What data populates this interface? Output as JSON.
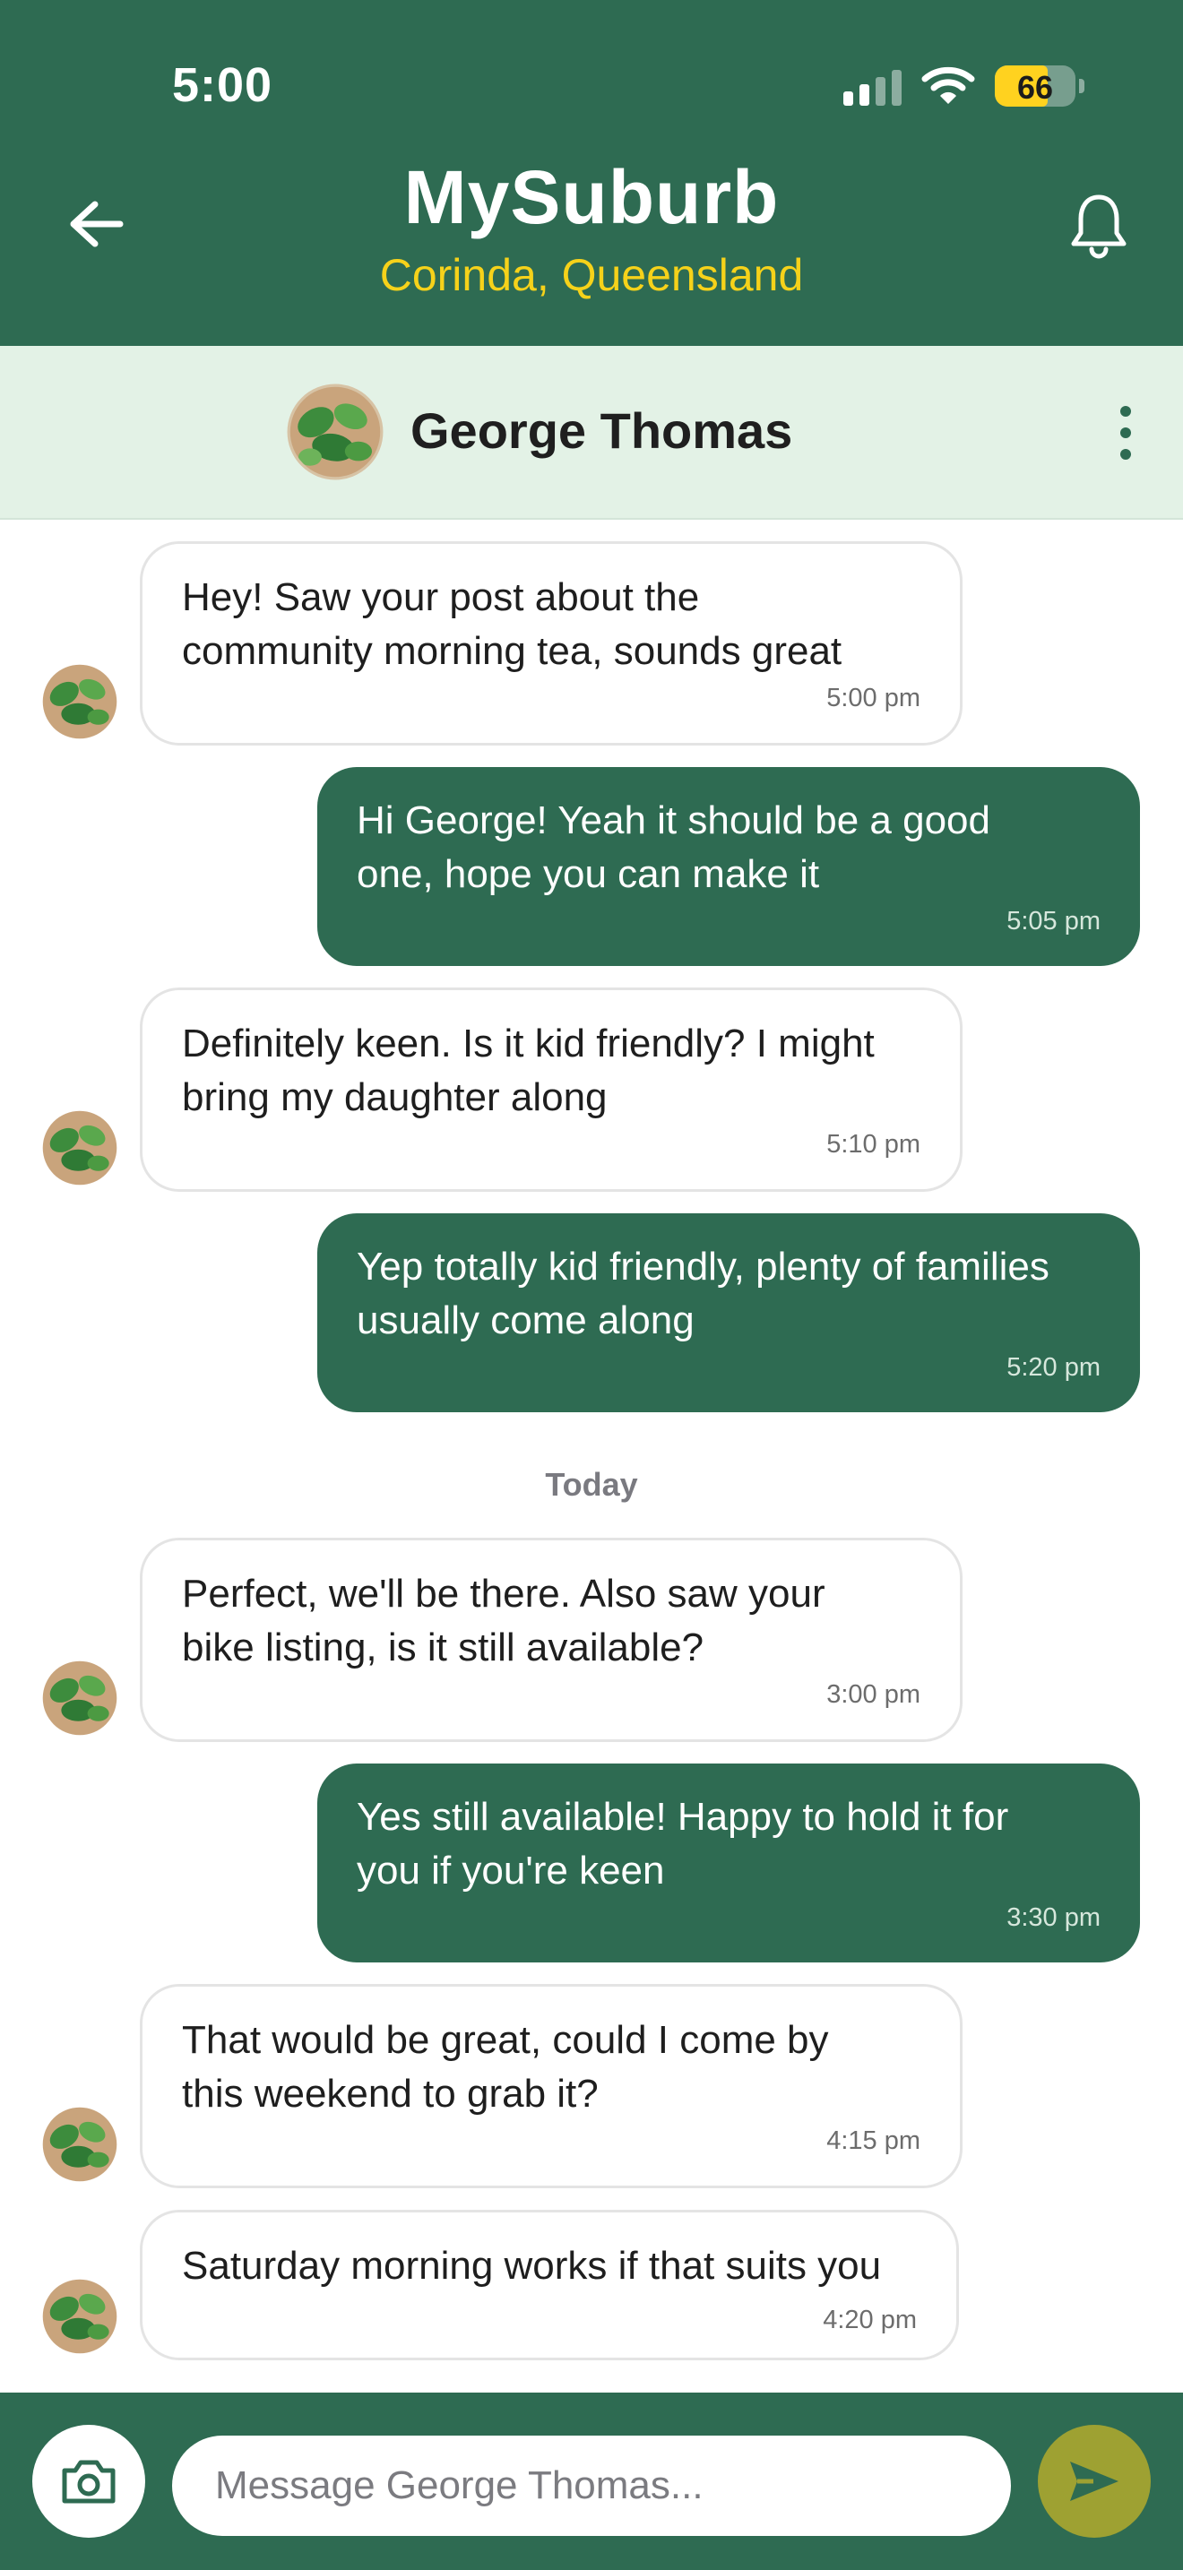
{
  "status_bar": {
    "time": "5:00",
    "battery": "66"
  },
  "header": {
    "title": "MySuburb",
    "subtitle": "Corinda, Queensland",
    "back_icon": "arrow-left-icon",
    "bell_icon": "bell-icon"
  },
  "contact": {
    "name": "George Thomas",
    "more_icon": "more-vertical-icon"
  },
  "messages": [
    {
      "from": "contact",
      "lines": [
        "Hey! Saw your post about the",
        "community morning tea, sounds great"
      ],
      "time": "5:00 pm"
    },
    {
      "from": "me",
      "lines": [
        "Hi George! Yeah it should be a good",
        "one, hope you can make it"
      ],
      "time": "5:05 pm"
    },
    {
      "from": "contact",
      "lines": [
        "Definitely keen. Is it kid friendly? I might",
        "bring my daughter along"
      ],
      "time": "5:10 pm"
    },
    {
      "from": "me",
      "lines": [
        "Yep totally kid friendly, plenty of families",
        "usually come along"
      ],
      "time": "5:20 pm"
    },
    {
      "from": "contact",
      "lines": [
        "Perfect, we'll be there. Also saw your",
        "bike listing, is it still available?"
      ],
      "time": "3:00 pm"
    },
    {
      "from": "me",
      "lines": [
        "Yes still available! Happy to hold it for",
        "you if you're keen"
      ],
      "time": "3:30 pm"
    },
    {
      "from": "contact",
      "lines": [
        "That would be great, could I come by",
        "this weekend to grab it?"
      ],
      "time": "4:15 pm"
    },
    {
      "from": "contact",
      "lines": [
        "Saturday morning works if that suits you"
      ],
      "time": "4:20 pm"
    }
  ],
  "date_divider": "Today",
  "composer": {
    "placeholder": "Message George Thomas...",
    "camera_icon": "camera-icon",
    "send_icon": "send-icon"
  },
  "colors": {
    "brand_green": "#2e6b52",
    "subtitle_yellow": "#f6d21a",
    "contact_bar": "#e3f2e6",
    "send_button": "#9ea132"
  }
}
